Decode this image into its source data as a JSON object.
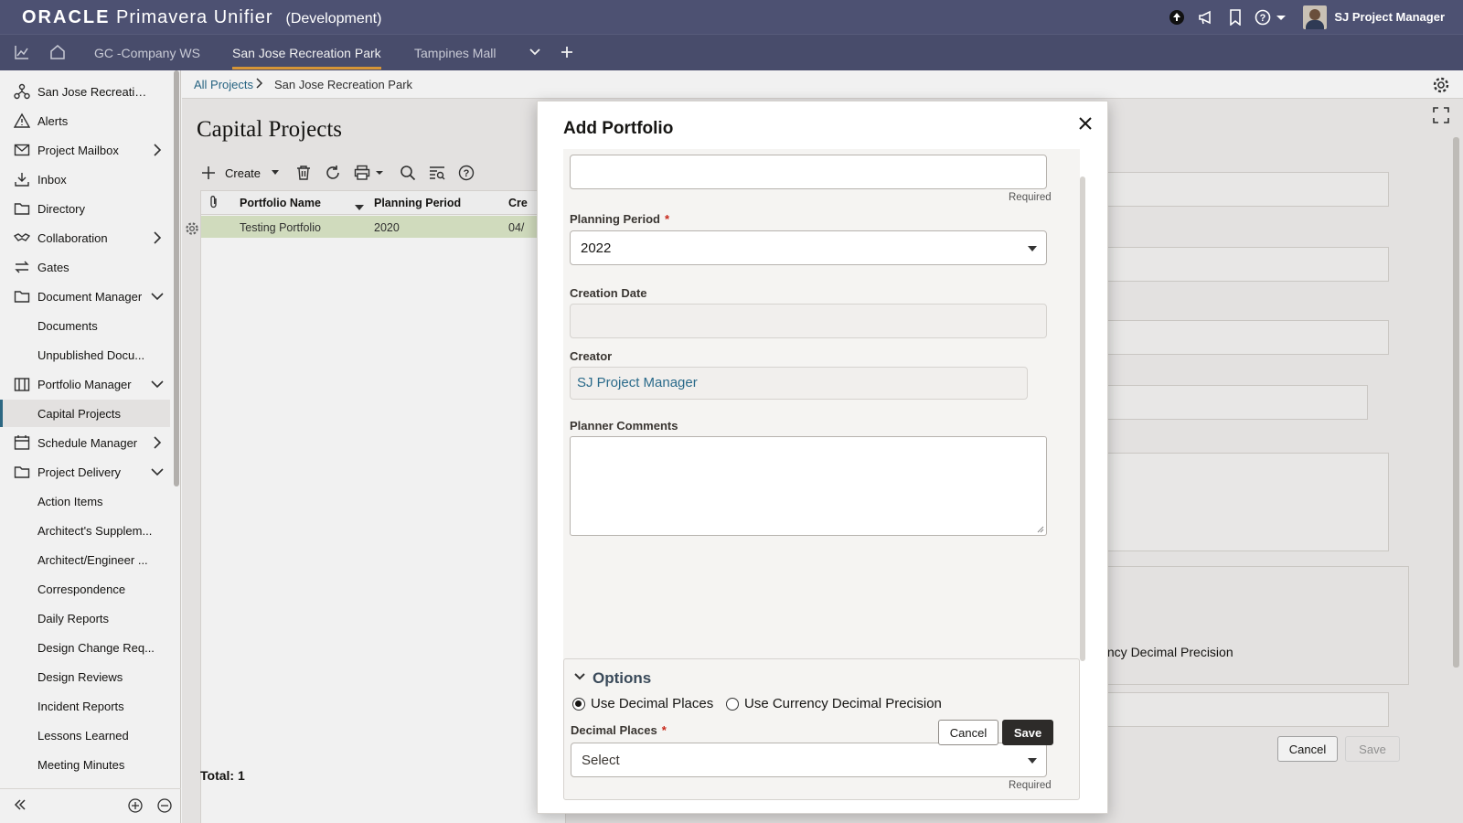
{
  "app": {
    "brand_oracle": "ORACLE",
    "brand_product": "Primavera Unifier",
    "environment": "(Development)",
    "user": "SJ Project Manager"
  },
  "tabs": [
    {
      "label": "GC -Company WS"
    },
    {
      "label": "San Jose Recreation Park"
    },
    {
      "label": "Tampines Mall"
    }
  ],
  "nav": {
    "items": [
      {
        "label": "San Jose Recreation..."
      },
      {
        "label": "Alerts"
      },
      {
        "label": "Project Mailbox"
      },
      {
        "label": "Inbox"
      },
      {
        "label": "Directory"
      },
      {
        "label": "Collaboration"
      },
      {
        "label": "Gates"
      },
      {
        "label": "Document Manager"
      },
      {
        "label": "Documents"
      },
      {
        "label": "Unpublished Docu..."
      },
      {
        "label": "Portfolio Manager"
      },
      {
        "label": "Capital Projects"
      },
      {
        "label": "Schedule Manager"
      },
      {
        "label": "Project Delivery"
      },
      {
        "label": "Action Items"
      },
      {
        "label": "Architect's Supplem..."
      },
      {
        "label": "Architect/Engineer ..."
      },
      {
        "label": "Correspondence"
      },
      {
        "label": "Daily Reports"
      },
      {
        "label": "Design Change Req..."
      },
      {
        "label": "Design Reviews"
      },
      {
        "label": "Incident Reports"
      },
      {
        "label": "Lessons Learned"
      },
      {
        "label": "Meeting Minutes"
      }
    ]
  },
  "breadcrumb": {
    "root": "All Projects",
    "current": "San Jose Recreation Park"
  },
  "main": {
    "title": "Capital Projects",
    "create_label": "Create",
    "columns": [
      "Portfolio Name",
      "Planning Period",
      "Cre"
    ],
    "rows": [
      {
        "name": "Testing Portfolio",
        "period": "2020",
        "created": "04/"
      }
    ],
    "total": "Total: 1",
    "bg_option_text": "urrency Decimal Precision",
    "bg_cancel": "Cancel",
    "bg_save": "Save"
  },
  "dialog": {
    "title": "Add Portfolio",
    "name_hint": "Required",
    "planning_period_label": "Planning Period",
    "planning_period_value": "2022",
    "creation_date_label": "Creation Date",
    "creator_label": "Creator",
    "creator_value": "SJ Project Manager",
    "comments_label": "Planner Comments",
    "options_title": "Options",
    "radio_decimal": "Use Decimal Places",
    "radio_currency": "Use Currency Decimal Precision",
    "decimal_places_label": "Decimal Places",
    "decimal_places_value": "Select",
    "decimal_hint": "Required",
    "cancel_label": "Cancel",
    "save_label": "Save"
  },
  "colors": {
    "topbar": "#4d5172",
    "accent_tab": "#e39e3a",
    "link": "#2a6a8a",
    "row_highlight": "#dde8c8"
  }
}
